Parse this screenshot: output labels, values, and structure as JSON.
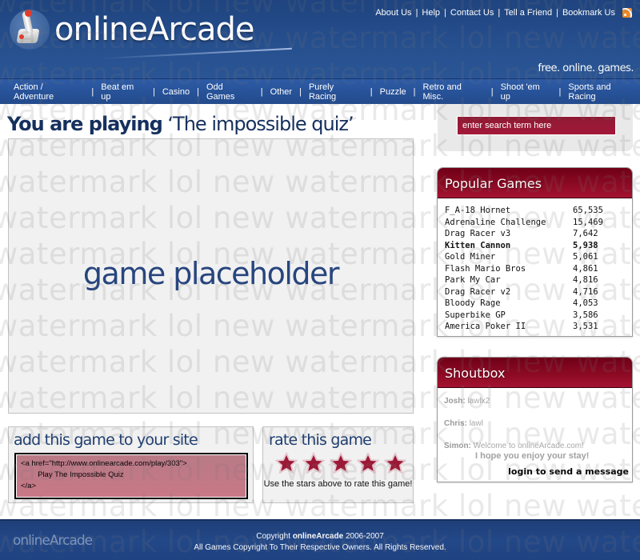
{
  "header": {
    "logo_text": "onlineArcade",
    "tagline": "free. online. games.",
    "top_links": [
      "About Us",
      "Help",
      "Contact Us",
      "Tell a Friend",
      "Bookmark Us"
    ],
    "rss_icon": "rss-feed-icon"
  },
  "nav": {
    "items": [
      "Action / Adventure",
      "Beat em up",
      "Casino",
      "Odd Games",
      "Other",
      "Purely Racing",
      "Puzzle",
      "Retro and Misc.",
      "Shoot 'em up",
      "Sports and Racing"
    ]
  },
  "main": {
    "title_prefix": "You are playing",
    "title_game": "‘The impossible quiz’",
    "game_placeholder": "game placeholder",
    "embed": {
      "heading": "add this game to your site",
      "code_line1": "<a href=\"http://www.onlinearcade.com/play/303\">",
      "code_line2": "        Play The Impossible Quiz",
      "code_line3": "</a>"
    },
    "rate": {
      "heading": "rate this game",
      "star_count": 5,
      "instruction": "Use the stars above to rate this game!",
      "star_color": "#9b1836"
    }
  },
  "sidebar": {
    "search_placeholder": "enter search term here",
    "popular": {
      "title": "Popular Games",
      "games": [
        {
          "name": "F_A-18 Hornet",
          "plays": "65,535",
          "bold": false
        },
        {
          "name": "Adrenaline Challenge",
          "plays": "15,469",
          "bold": false
        },
        {
          "name": "Drag Racer v3",
          "plays": "7,642",
          "bold": false
        },
        {
          "name": "Kitten Cannon",
          "plays": "5,938",
          "bold": true
        },
        {
          "name": "Gold Miner",
          "plays": "5,061",
          "bold": false
        },
        {
          "name": "Flash Mario Bros",
          "plays": "4,861",
          "bold": false
        },
        {
          "name": "Park My Car",
          "plays": "4,816",
          "bold": false
        },
        {
          "name": "Drag Racer v2",
          "plays": "4,716",
          "bold": false
        },
        {
          "name": "Bloody Rage",
          "plays": "4,053",
          "bold": false
        },
        {
          "name": "Superbike GP",
          "plays": "3,586",
          "bold": false
        },
        {
          "name": "America Poker II",
          "plays": "3,531",
          "bold": false
        }
      ]
    },
    "shoutbox": {
      "title": "Shoutbox",
      "messages": [
        {
          "user": "Josh:",
          "text": "lawlx2",
          "cont": ""
        },
        {
          "user": "Chris:",
          "text": "lawl",
          "cont": ""
        },
        {
          "user": "Simon:",
          "text": "Welcome to onlineArcade.com!",
          "cont": "I hope you enjoy your stay!"
        }
      ],
      "login_link": "login to send a message"
    }
  },
  "footer": {
    "logo_text": "onlineArcade",
    "copyright_prefix": "Copyright",
    "copyright_brand": "onlineArcade",
    "copyright_years": "2006-2007",
    "rights": "All Games Copyright To Their Respective Owners. All Rights Reserved."
  },
  "watermark": {
    "text": "watermark lol new watermark lol new watermark lol new"
  },
  "colors": {
    "header_blue": "#24498a",
    "title_blue": "#15305e",
    "accent_red": "#9b1836"
  }
}
